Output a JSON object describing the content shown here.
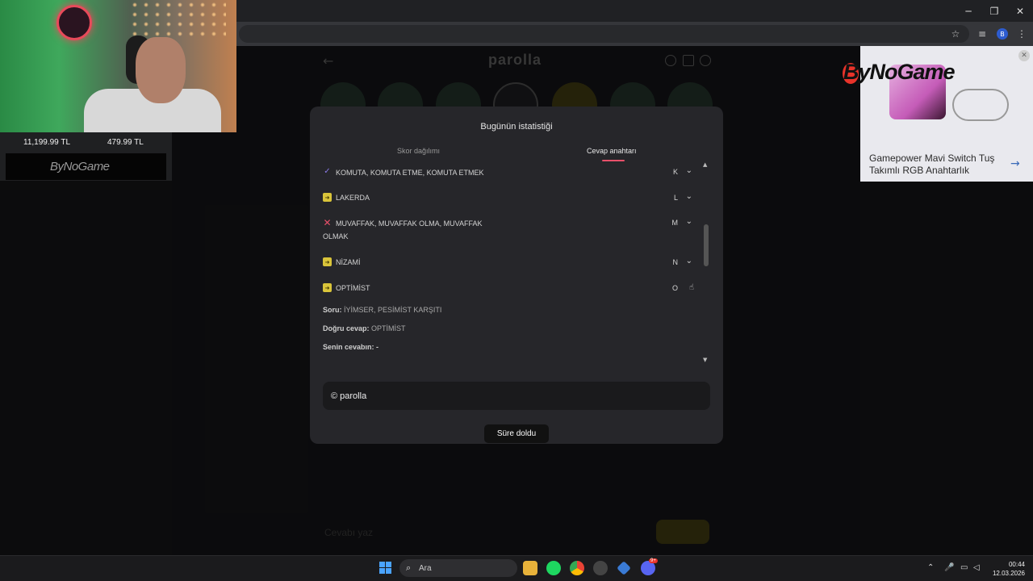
{
  "browser": {
    "window_controls": [
      "─",
      "❐",
      "✕"
    ]
  },
  "app": {
    "title": "parolla",
    "back_icon": "arrow-left-icon",
    "input_placeholder": "Cevabı yaz"
  },
  "modal": {
    "title": "Bugünün istatistiği",
    "tabs": [
      {
        "label": "Skor dağılımı",
        "active": false
      },
      {
        "label": "Cevap anahtarı",
        "active": true
      }
    ],
    "rows": [
      {
        "icon": "check-icon",
        "text": "KOMUTA, KOMUTA ETME, KOMUTA ETMEK",
        "letter": "K"
      },
      {
        "icon": "pass-icon",
        "text": "LAKERDA",
        "letter": "L"
      },
      {
        "icon": "cross-icon",
        "text_line1": "MUVAFFAK, MUVAFFAK OLMA, MUVAFFAK",
        "text_line2": "OLMAK",
        "letter": "M"
      },
      {
        "icon": "pass-icon",
        "text": "NİZAMİ",
        "letter": "N"
      },
      {
        "icon": "pass-icon",
        "text": "OPTİMİST",
        "letter": "O"
      }
    ],
    "detail": {
      "question_label": "Soru:",
      "question": "İYİMSER, PESİMİST KARŞITI",
      "answer_label": "Doğru cevap:",
      "answer": "OPTİMİST",
      "your_answer_label": "Senin cevabın:",
      "your_answer": "-"
    },
    "brand": "© parolla",
    "time_up_button": "Süre doldu"
  },
  "stream": {
    "price_1": "11,199.99 TL",
    "price_2": "479.99 TL",
    "sponsor": "ByNoGame",
    "ad_text": "Gamepower Mavi Switch Tuş Takımlı RGB Anahtarlık"
  },
  "taskbar": {
    "search_label": "Ara",
    "time": "00:44",
    "date": "12.03.2026",
    "discord_badge": "9+"
  }
}
